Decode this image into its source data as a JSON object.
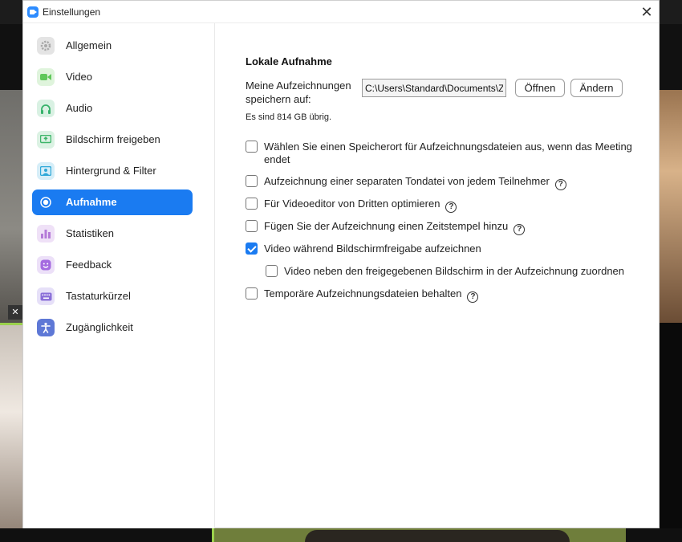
{
  "window": {
    "title": "Einstellungen",
    "close_label": "✕"
  },
  "sidebar": {
    "items": [
      {
        "label": "Allgemein",
        "icon": "gear-icon",
        "color": "#bdbdbd"
      },
      {
        "label": "Video",
        "icon": "video-camera-icon",
        "color": "#5fc75a"
      },
      {
        "label": "Audio",
        "icon": "headphones-icon",
        "color": "#37b26b"
      },
      {
        "label": "Bildschirm freigeben",
        "icon": "screen-share-icon",
        "color": "#3eb56a"
      },
      {
        "label": "Hintergrund & Filter",
        "icon": "background-icon",
        "color": "#2fa8d8"
      },
      {
        "label": "Aufnahme",
        "icon": "record-icon",
        "color": "#ffffff",
        "active": true
      },
      {
        "label": "Statistiken",
        "icon": "bar-chart-icon",
        "color": "#b57bd8"
      },
      {
        "label": "Feedback",
        "icon": "smiley-icon",
        "color": "#a56be0"
      },
      {
        "label": "Tastaturkürzel",
        "icon": "keyboard-icon",
        "color": "#8a6fd8"
      },
      {
        "label": "Zugänglichkeit",
        "icon": "accessibility-icon",
        "color": "#5e78d6"
      }
    ]
  },
  "content": {
    "section_title": "Lokale Aufnahme",
    "path_label": "Meine Aufzeichnungen speichern auf:",
    "path_value": "C:\\Users\\Standard\\Documents\\Zoom",
    "open_button": "Öffnen",
    "change_button": "Ändern",
    "free_space": "Es sind 814 GB übrig.",
    "options": [
      {
        "label": "Wählen Sie einen Speicherort für Aufzeichnungsdateien aus, wenn das Meeting endet",
        "checked": false,
        "help": false
      },
      {
        "label": "Aufzeichnung einer separaten Tondatei von jedem Teilnehmer",
        "checked": false,
        "help": true
      },
      {
        "label": "Für Videoeditor von Dritten optimieren",
        "checked": false,
        "help": true
      },
      {
        "label": "Fügen Sie der Aufzeichnung einen Zeitstempel hinzu",
        "checked": false,
        "help": true
      },
      {
        "label": "Video während Bildschirmfreigabe aufzeichnen",
        "checked": true,
        "help": false
      },
      {
        "label": "Video neben den freigegebenen Bildschirm in der Aufzeichnung zuordnen",
        "checked": false,
        "help": false
      },
      {
        "label": "Temporäre Aufzeichnungsdateien behalten",
        "checked": false,
        "help": true
      }
    ],
    "help_glyph": "?"
  },
  "colors": {
    "accent": "#1a7bf1"
  }
}
